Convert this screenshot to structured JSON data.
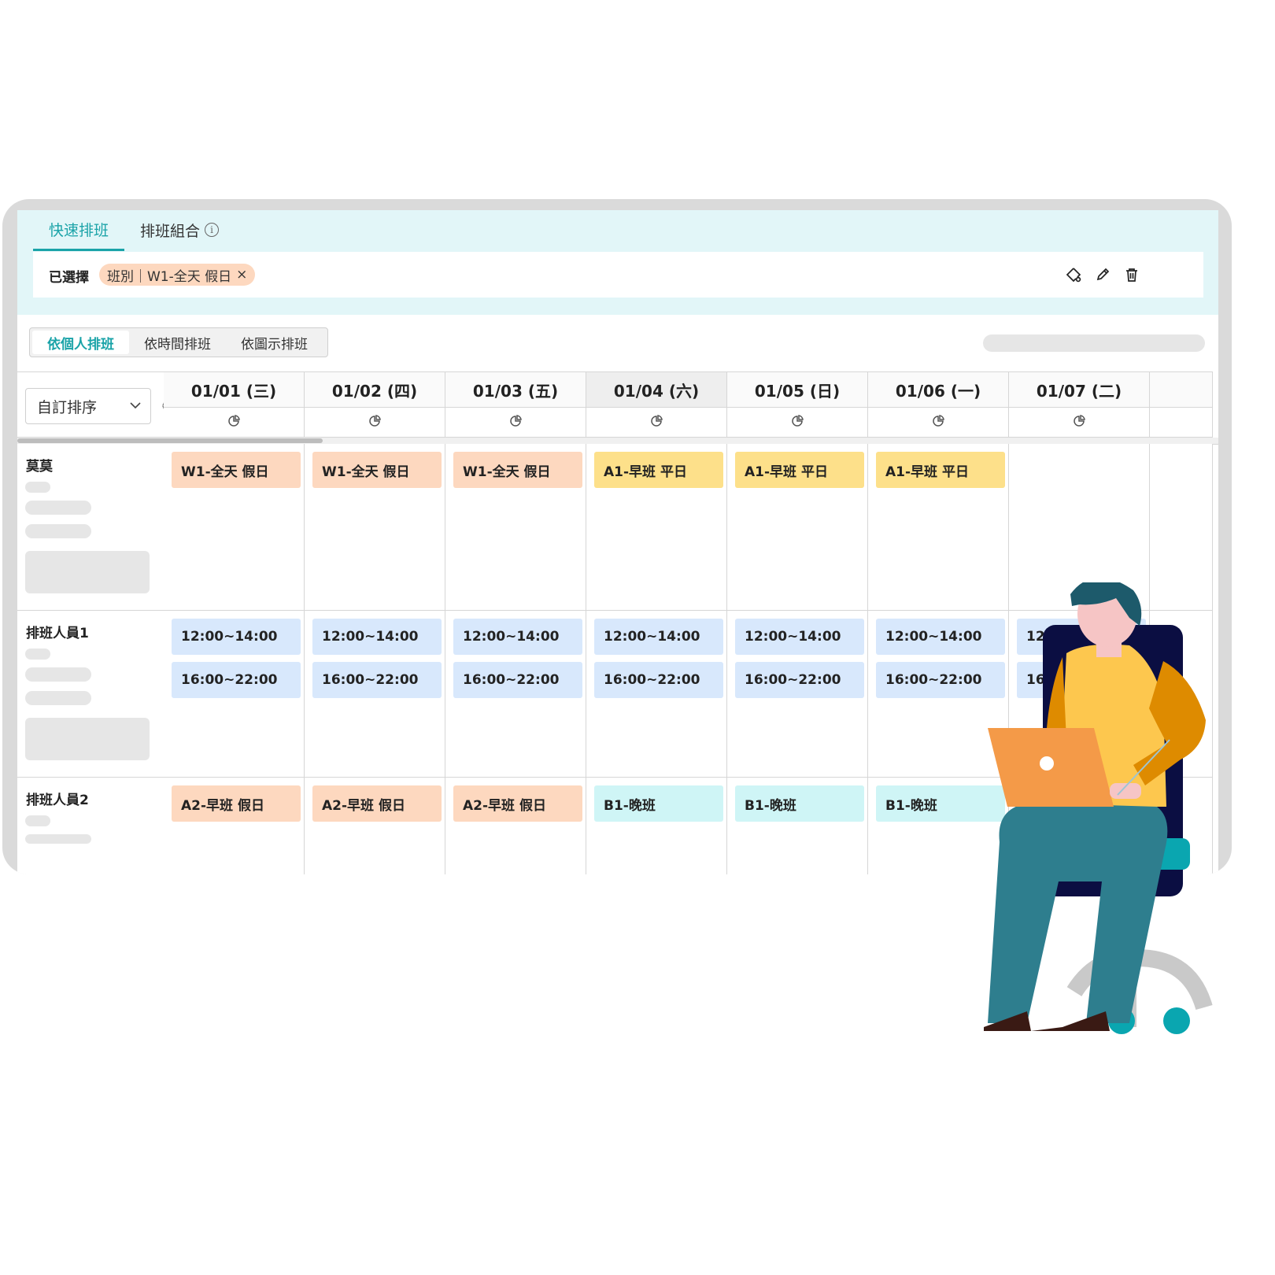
{
  "tabs": [
    {
      "label": "快速排班",
      "active": true
    },
    {
      "label": "排班組合",
      "active": false
    }
  ],
  "selection": {
    "label": "已選擇",
    "chip": "班別｜W1-全天 假日",
    "chip_close": "×"
  },
  "view_modes": [
    {
      "label": "依個人排班",
      "active": true
    },
    {
      "label": "依時間排班",
      "active": false
    },
    {
      "label": "依圖示排班",
      "active": false
    }
  ],
  "sort": {
    "label": "自訂排序"
  },
  "days": [
    {
      "label": "01/01 (三)",
      "weekend": false
    },
    {
      "label": "01/02 (四)",
      "weekend": false
    },
    {
      "label": "01/03 (五)",
      "weekend": false
    },
    {
      "label": "01/04 (六)",
      "weekend": true
    },
    {
      "label": "01/05 (日)",
      "weekend": false
    },
    {
      "label": "01/06 (一)",
      "weekend": false
    },
    {
      "label": "01/07 (二)",
      "weekend": false
    }
  ],
  "rows": [
    {
      "name": "莫莫",
      "shifts": [
        [
          {
            "text": "W1-全天 假日",
            "color": "orange"
          }
        ],
        [
          {
            "text": "W1-全天 假日",
            "color": "orange"
          }
        ],
        [
          {
            "text": "W1-全天 假日",
            "color": "orange"
          }
        ],
        [
          {
            "text": "A1-早班 平日",
            "color": "yellow"
          }
        ],
        [
          {
            "text": "A1-早班 平日",
            "color": "yellow"
          }
        ],
        [
          {
            "text": "A1-早班 平日",
            "color": "yellow"
          }
        ],
        []
      ]
    },
    {
      "name": "排班人員1",
      "shifts": [
        [
          {
            "text": "12:00~14:00",
            "color": "blue"
          },
          {
            "text": "16:00~22:00",
            "color": "blue"
          }
        ],
        [
          {
            "text": "12:00~14:00",
            "color": "blue"
          },
          {
            "text": "16:00~22:00",
            "color": "blue"
          }
        ],
        [
          {
            "text": "12:00~14:00",
            "color": "blue"
          },
          {
            "text": "16:00~22:00",
            "color": "blue"
          }
        ],
        [
          {
            "text": "12:00~14:00",
            "color": "blue"
          },
          {
            "text": "16:00~22:00",
            "color": "blue"
          }
        ],
        [
          {
            "text": "12:00~14:00",
            "color": "blue"
          },
          {
            "text": "16:00~22:00",
            "color": "blue"
          }
        ],
        [
          {
            "text": "12:00~14:00",
            "color": "blue"
          },
          {
            "text": "16:00~22:00",
            "color": "blue"
          }
        ],
        [
          {
            "text": "12:00~14:00",
            "color": "blue"
          },
          {
            "text": "16:00~22:00",
            "color": "blue"
          }
        ]
      ]
    },
    {
      "name": "排班人員2",
      "shifts": [
        [
          {
            "text": "A2-早班 假日",
            "color": "orange"
          }
        ],
        [
          {
            "text": "A2-早班 假日",
            "color": "orange"
          }
        ],
        [
          {
            "text": "A2-早班 假日",
            "color": "orange"
          }
        ],
        [
          {
            "text": "B1-晚班",
            "color": "cyan"
          }
        ],
        [
          {
            "text": "B1-晚班",
            "color": "cyan"
          }
        ],
        [
          {
            "text": "B1-晚班",
            "color": "cyan"
          }
        ],
        []
      ]
    }
  ],
  "icons": {
    "tab_info": "info-icon",
    "toolbar": [
      "palette-icon",
      "pencil-icon",
      "trash-icon"
    ],
    "day_stats": "pie-chart-icon",
    "sort_dropdown": "chevron-down-icon",
    "sort_order": "sort-arrows-icon"
  },
  "colors": {
    "accent": "#1aa3a8",
    "orange": "#fdd8bf",
    "yellow": "#fde08a",
    "blue": "#d8e8fc",
    "cyan": "#cff5f6"
  }
}
